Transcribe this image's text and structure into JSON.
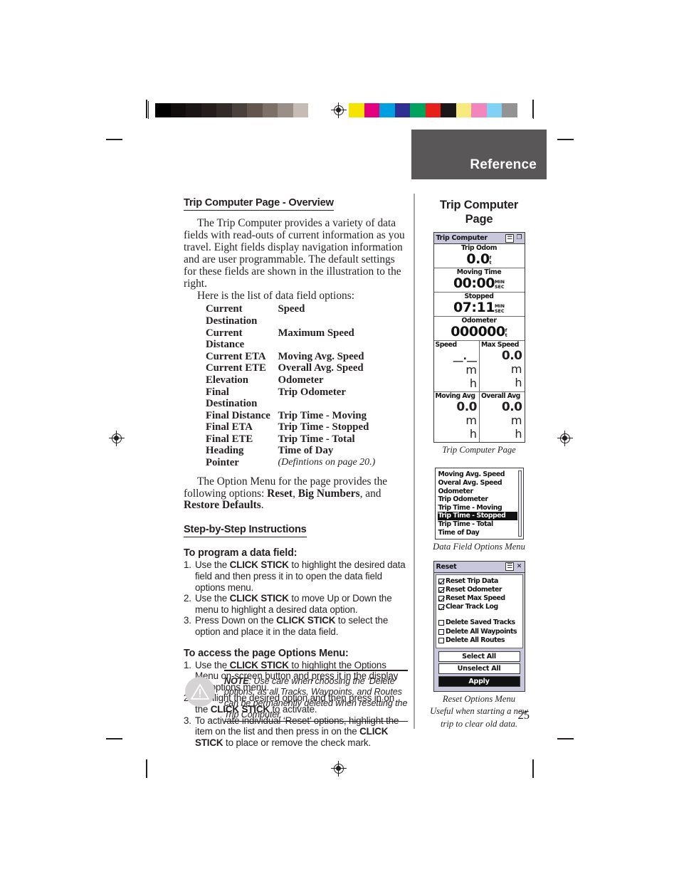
{
  "printer_marks": {
    "grayscale_swatches": [
      "#000000",
      "#110d0d",
      "#1b1515",
      "#241d1c",
      "#322a27",
      "#4a403c",
      "#63564f",
      "#7d7069",
      "#9a8f88",
      "#c6bcb6",
      "#ffffff"
    ],
    "color_swatches": [
      "#f5e400",
      "#e5007e",
      "#00a0e0",
      "#2e3191",
      "#00a45e",
      "#e8201a",
      "#1b1716",
      "#f8ea7d",
      "#f185bc",
      "#7fd2f5",
      "#939393"
    ]
  },
  "header": {
    "tab_label": "Reference",
    "tab_color": "#595757"
  },
  "left_column": {
    "section_heading": "Trip Computer Page - Overview",
    "intro_paragraph": "The Trip Computer provides a variety of data fields with read-outs of current information as you travel. Eight fields display navigation information and are user programmable. The default settings for these fields are shown in the illustration to the right.",
    "list_lead_in": "Here is the list of data field options:",
    "data_field_options": [
      {
        "col1": "Current Destination",
        "col2": "Speed"
      },
      {
        "col1": "Current Distance",
        "col2": "Maximum Speed"
      },
      {
        "col1": "Current ETA",
        "col2": "Moving Avg. Speed"
      },
      {
        "col1": "Current ETE",
        "col2": "Overall Avg. Speed"
      },
      {
        "col1": "Elevation",
        "col2": "Odometer"
      },
      {
        "col1": "Final Destination",
        "col2": "Trip Odometer"
      },
      {
        "col1": "Final Distance",
        "col2": "Trip Time - Moving"
      },
      {
        "col1": "Final ETA",
        "col2": "Trip Time - Stopped"
      },
      {
        "col1": "Final ETE",
        "col2": "Trip Time - Total"
      },
      {
        "col1": "Heading",
        "col2": "Time of Day"
      },
      {
        "col1": "Pointer",
        "col2": "(Defintions on page 20.)"
      }
    ],
    "option_menu_paragraph_pre": "The Option Menu for the page provides the following options: ",
    "option_menu_items": [
      "Reset",
      "Big Numbers",
      "Restore Defaults"
    ],
    "option_menu_paragraph_post": ".",
    "step_by_step_heading": "Step-by-Step Instructions",
    "instructions": [
      {
        "title": "To program a data field:",
        "steps": [
          {
            "num": "1.",
            "pre": "Use the ",
            "bold": "CLICK STICK",
            "post": " to highlight the desired data field and then press it in to open the data field options menu."
          },
          {
            "num": "2.",
            "pre": "Use the ",
            "bold": "CLICK STICK",
            "post": " to move Up or Down the menu to highlight a desired data option."
          },
          {
            "num": "3.",
            "pre": "Press Down on the ",
            "bold": "CLICK STICK",
            "post": " to select the option and place it in the data field."
          }
        ]
      },
      {
        "title": "To access the page Options Menu:",
        "steps": [
          {
            "num": "1.",
            "pre": "Use the ",
            "bold": "CLICK STICK",
            "post": " to highlight the Options Menu on-screen button and press it in the display the options menu."
          },
          {
            "num": "2.",
            "pre": "Highlight the desired option and then press in on the ",
            "bold": "CLICK STICK",
            "post": " to activate."
          },
          {
            "num": "3.",
            "pre": "To activate individual ‘Reset’ options, highlight the item on the list and then press in on the ",
            "bold": "CLICK STICK",
            "post": " to place or remove the check mark."
          }
        ]
      }
    ],
    "note": {
      "label": "NOTE",
      "text": ": Use care when choosing the ‘Delete’ options, as all Tracks, Waypoints, and Routes can be permanently deleted when resetting the Trip Computer."
    }
  },
  "right_column": {
    "title_line1": "Trip Computer",
    "title_line2": "Page",
    "trip_computer_screen": {
      "window_title": "Trip Computer",
      "titlebar_buttons": [
        "menu-icon",
        "copy-icon"
      ],
      "full_fields": [
        {
          "label": "Trip Odom",
          "value": "0.0",
          "unit_top": "f",
          "unit_bottom": "t"
        },
        {
          "label": "Moving Time",
          "value": "00:00",
          "unit_top": "MIN",
          "unit_bottom": "SEC"
        },
        {
          "label": "Stopped",
          "value": "07:11",
          "unit_top": "MIN",
          "unit_bottom": "SEC"
        },
        {
          "label": "Odometer",
          "value": "000000",
          "unit_top": "f",
          "unit_bottom": "t"
        }
      ],
      "half_fields": [
        {
          "label": "Speed",
          "value": "__.__",
          "unit_top": "m",
          "unit_bottom": "h"
        },
        {
          "label": "Max Speed",
          "value": "0.0",
          "unit_top": "m",
          "unit_bottom": "h"
        },
        {
          "label": "Moving Avg",
          "value": "0.0",
          "unit_top": "m",
          "unit_bottom": "h"
        },
        {
          "label": "Overall Avg",
          "value": "0.0",
          "unit_top": "m",
          "unit_bottom": "h"
        }
      ],
      "caption": "Trip Computer Page"
    },
    "data_field_options_screen": {
      "items": [
        {
          "label": "Moving Avg. Speed",
          "selected": false
        },
        {
          "label": "Overal Avg. Speed",
          "selected": false
        },
        {
          "label": "Odometer",
          "selected": false
        },
        {
          "label": "Trip Odometer",
          "selected": false
        },
        {
          "label": "Trip Time - Moving",
          "selected": false
        },
        {
          "label": "Trip Time - Stopped",
          "selected": true
        },
        {
          "label": "Trip Time - Total",
          "selected": false
        },
        {
          "label": "Time of Day",
          "selected": false
        }
      ],
      "caption": "Data Field Options Menu"
    },
    "reset_screen": {
      "window_title": "Reset",
      "titlebar_buttons": [
        "menu-icon",
        "close-icon"
      ],
      "checkbox_group_1": [
        {
          "label": "Reset Trip Data",
          "checked": true
        },
        {
          "label": "Reset Odometer",
          "checked": true
        },
        {
          "label": "Reset Max Speed",
          "checked": true
        },
        {
          "label": "Clear Track Log",
          "checked": true
        }
      ],
      "checkbox_group_2": [
        {
          "label": "Delete Saved Tracks",
          "checked": false
        },
        {
          "label": "Delete All Waypoints",
          "checked": false
        },
        {
          "label": "Delete All Routes",
          "checked": false
        }
      ],
      "buttons": [
        {
          "label": "Select All",
          "primary": false
        },
        {
          "label": "Unselect All",
          "primary": false
        },
        {
          "label": "Apply",
          "primary": true
        }
      ],
      "caption_line1": "Reset Options Menu",
      "caption_line2": "Useful when starting a new",
      "caption_line3": "trip to clear old data."
    }
  },
  "page_number": "25"
}
